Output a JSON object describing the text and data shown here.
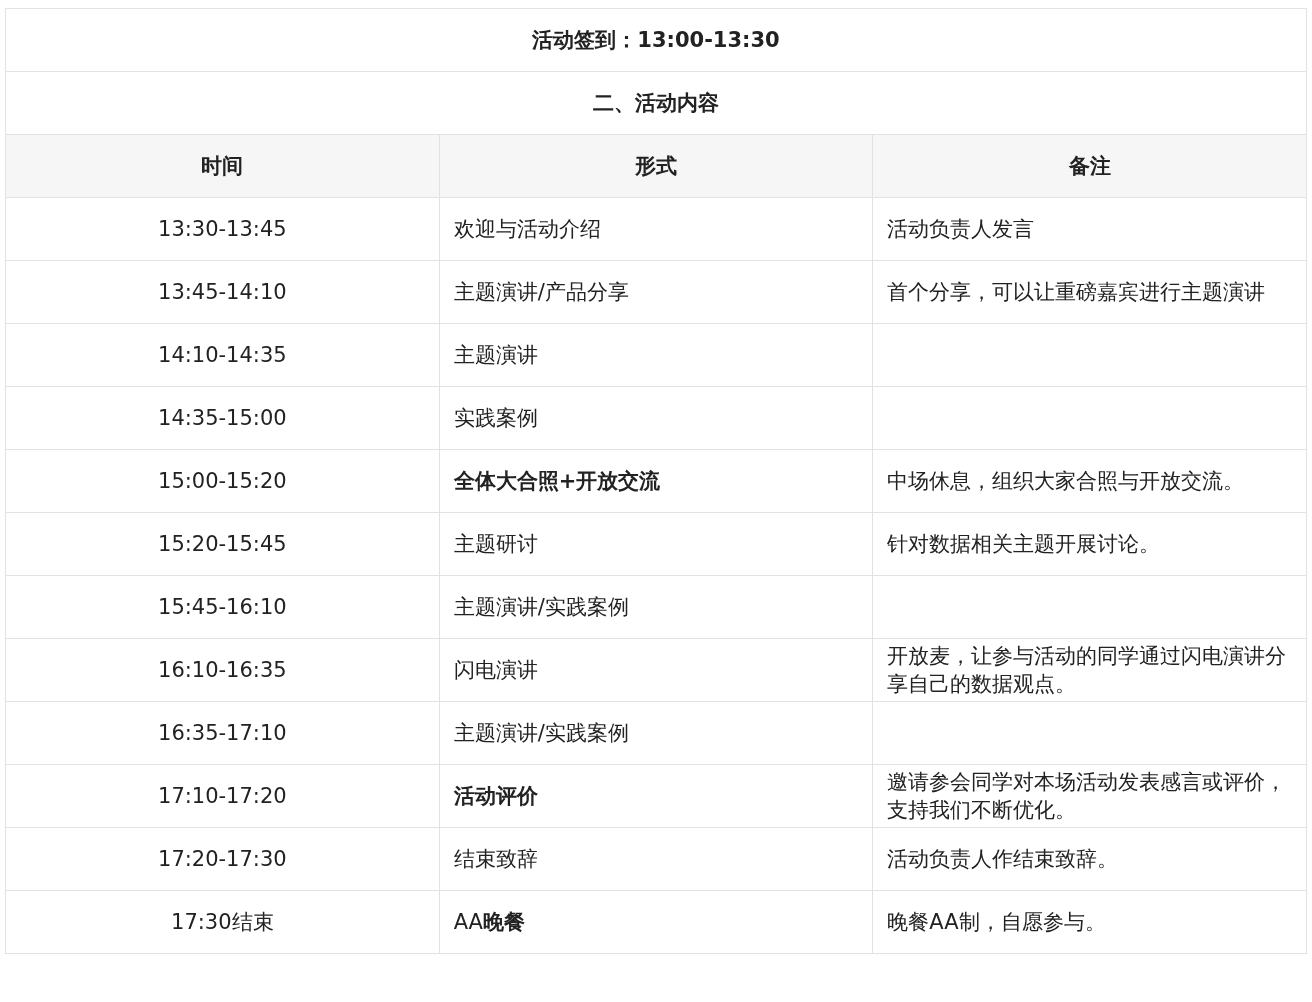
{
  "title_rows": [
    "活动签到：13:00-13:30",
    "二、活动内容"
  ],
  "columns": [
    "时间",
    "形式",
    "备注"
  ],
  "rows": [
    {
      "time": "13:30-13:45",
      "form": "欢迎与活动介绍",
      "form_bold": false,
      "note": "活动负责人发言"
    },
    {
      "time": "13:45-14:10",
      "form": "主题演讲/产品分享",
      "form_bold": false,
      "note": "首个分享，可以让重磅嘉宾进行主题演讲"
    },
    {
      "time": "14:10-14:35",
      "form": "主题演讲",
      "form_bold": false,
      "note": ""
    },
    {
      "time": "14:35-15:00",
      "form": "实践案例",
      "form_bold": false,
      "note": ""
    },
    {
      "time": "15:00-15:20",
      "form": "全体大合照+开放交流",
      "form_bold": true,
      "note": "中场休息，组织大家合照与开放交流。"
    },
    {
      "time": "15:20-15:45",
      "form": "主题研讨",
      "form_bold": false,
      "note": "针对数据相关主题开展讨论。"
    },
    {
      "time": "15:45-16:10",
      "form": "主题演讲/实践案例",
      "form_bold": false,
      "note": ""
    },
    {
      "time": "16:10-16:35",
      "form": "闪电演讲",
      "form_bold": false,
      "note": "开放麦，让参与活动的同学通过闪电演讲分享自己的数据观点。"
    },
    {
      "time": "16:35-17:10",
      "form": "主题演讲/实践案例",
      "form_bold": false,
      "note": ""
    },
    {
      "time": "17:10-17:20",
      "form": "活动评价",
      "form_bold": true,
      "note": "邀请参会同学对本场活动发表感言或评价，支持我们不断优化。"
    },
    {
      "time": "17:20-17:30",
      "form": "结束致辞",
      "form_bold": false,
      "note": "活动负责人作结束致辞。"
    },
    {
      "time": "17:30结束",
      "form": "AA**晚餐**",
      "form_bold": false,
      "note": "晚餐AA制，自愿参与。"
    }
  ]
}
